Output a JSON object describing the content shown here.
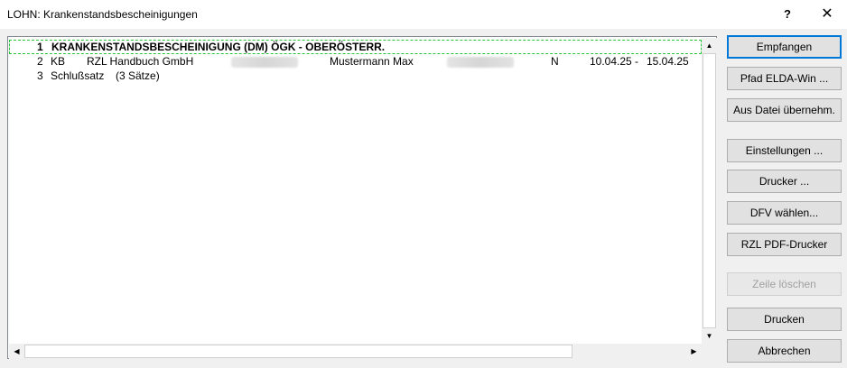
{
  "window": {
    "title": "LOHN: Krankenstandsbescheinigungen",
    "help_label": "?",
    "close_label": "✕"
  },
  "list": {
    "rows": [
      {
        "num": "1",
        "text": "KRANKENSTANDSBESCHEINIGUNG (DM) ÖGK - OBERÖSTERR."
      },
      {
        "num": "2",
        "type": "KB",
        "company": "RZL Handbuch GmbH",
        "name": "Mustermann Max",
        "flag": "N",
        "date_from": "10.04.25 -",
        "date_to": "15.04.25"
      },
      {
        "num": "3",
        "type": "Schlußsatz",
        "info": "(3 Sätze)"
      }
    ]
  },
  "scroll": {
    "up_icon": "▲",
    "down_icon": "▼",
    "left_icon": "◀",
    "right_icon": "▶"
  },
  "buttons": {
    "empfangen": "Empfangen",
    "pfad": "Pfad ELDA-Win ...",
    "aus_datei": "Aus Datei übernehm.",
    "einstellungen": "Einstellungen ...",
    "drucker": "Drucker ...",
    "dfv": "DFV wählen...",
    "pdf": "RZL PDF-Drucker",
    "zeile_loeschen": "Zeile löschen",
    "drucken": "Drucken",
    "abbrechen": "Abbrechen"
  }
}
